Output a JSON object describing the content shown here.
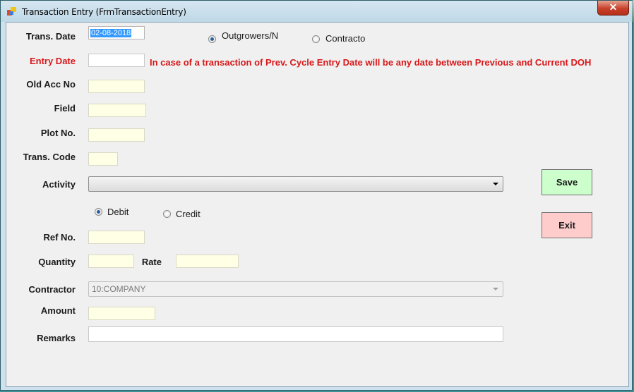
{
  "window": {
    "title": "Transaction Entry (FrmTransactionEntry)",
    "close_label": "✕"
  },
  "form": {
    "trans_date": {
      "label": "Trans. Date",
      "value": "02-08-2018"
    },
    "entry_date": {
      "label": "Entry Date",
      "value": ""
    },
    "note": "In case of a transaction of Prev. Cycle Entry Date will be any date between Previous and Current DOH",
    "old_acc_no": {
      "label": "Old Acc No",
      "value": ""
    },
    "field": {
      "label": "Field",
      "value": ""
    },
    "plot_no": {
      "label": "Plot No.",
      "value": ""
    },
    "trans_code": {
      "label": "Trans. Code",
      "value": ""
    },
    "activity": {
      "label": "Activity",
      "value": ""
    },
    "ref_no": {
      "label": "Ref No.",
      "value": ""
    },
    "quantity": {
      "label": "Quantity",
      "value": ""
    },
    "rate": {
      "label": "Rate",
      "value": ""
    },
    "contractor": {
      "label": "Contractor",
      "value": "10:COMPANY"
    },
    "amount": {
      "label": "Amount",
      "value": ""
    },
    "remarks": {
      "label": "Remarks",
      "value": ""
    }
  },
  "type_radios": {
    "outgrowers": {
      "label": "Outgrowers/N",
      "checked": true
    },
    "contracto": {
      "label": "Contracto",
      "checked": false
    }
  },
  "dc_radios": {
    "debit": {
      "label": "Debit",
      "checked": true
    },
    "credit": {
      "label": "Credit",
      "checked": false
    }
  },
  "buttons": {
    "save": "Save",
    "exit": "Exit"
  },
  "colors": {
    "required_label": "#d8181a",
    "input_bg": "#ffffe6",
    "save_bg": "#ccffcc",
    "exit_bg": "#ffcccc"
  }
}
